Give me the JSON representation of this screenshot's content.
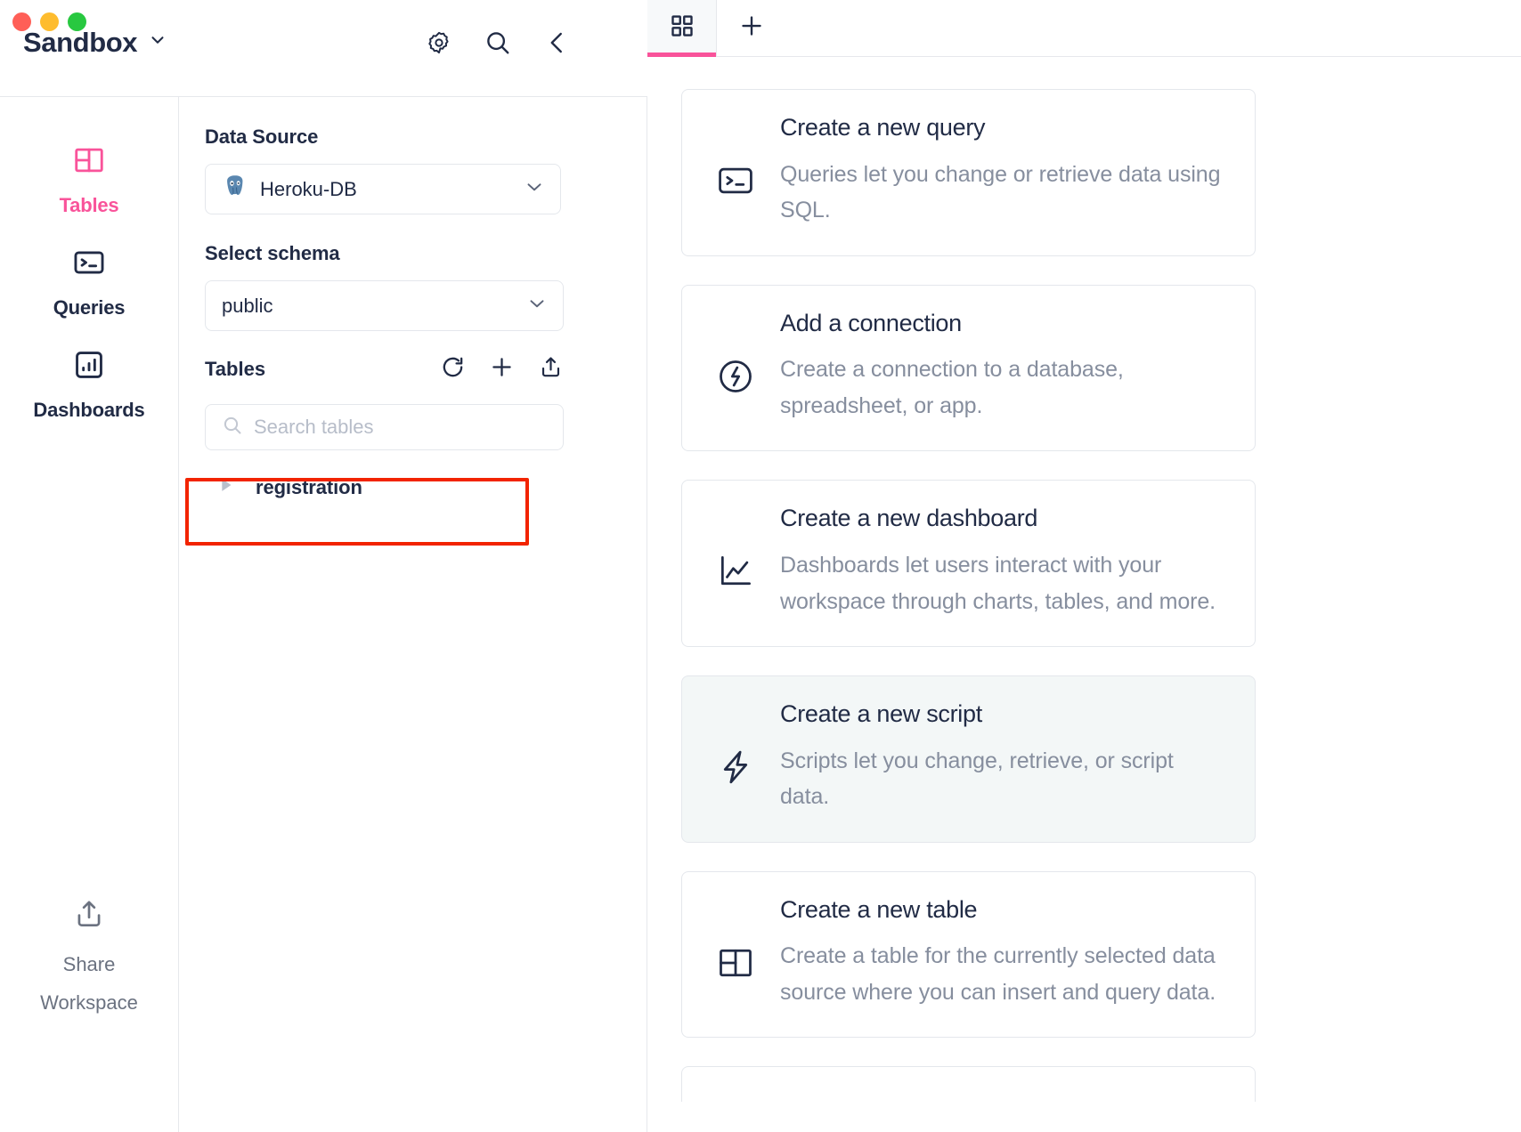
{
  "titlebar": {
    "workspace_name": "Sandbox",
    "workspace_chevron": "chevron-down-icon",
    "actions": [
      {
        "name": "settings-icon",
        "label": "Settings"
      },
      {
        "name": "search-icon",
        "label": "Search"
      },
      {
        "name": "collapse-icon",
        "label": "Collapse sidebar"
      }
    ]
  },
  "rail": {
    "items": [
      {
        "label": "Tables",
        "icon": "tables-icon",
        "active": true
      },
      {
        "label": "Queries",
        "icon": "terminal-icon",
        "active": false
      },
      {
        "label": "Dashboards",
        "icon": "chart-icon",
        "active": false
      }
    ],
    "bottom": {
      "label_line1": "Share",
      "label_line2": "Workspace",
      "icon": "share-upload-icon"
    },
    "active_color": "#f9539a",
    "inactive_color": "#212b45"
  },
  "panel": {
    "data_source_label": "Data Source",
    "data_source_value": "Heroku-DB",
    "data_source_icon": "postgresql-icon",
    "schema_label": "Select schema",
    "schema_value": "public",
    "tables_label": "Tables",
    "tables_actions": [
      {
        "name": "refresh-icon",
        "label": "Refresh"
      },
      {
        "name": "plus-icon",
        "label": "Add table"
      },
      {
        "name": "upload-icon",
        "label": "Import"
      }
    ],
    "search_placeholder": "Search tables",
    "search_value": "",
    "tables": [
      {
        "name": "registration",
        "expanded": false,
        "highlighted": true
      }
    ],
    "highlight_color": "#f22400"
  },
  "main": {
    "tabs": [
      {
        "icon": "grid-icon",
        "active": true,
        "label": "Home"
      }
    ],
    "add_tab_icon": "plus-icon",
    "accent_color": "#f9539a",
    "cards": [
      {
        "title": "Create a new query",
        "desc": "Queries let you change or retrieve data using SQL.",
        "icon": "terminal-icon",
        "hovered": false
      },
      {
        "title": "Add a connection",
        "desc": "Create a connection to a database, spreadsheet, or app.",
        "icon": "connection-bolt-circle-icon",
        "hovered": false
      },
      {
        "title": "Create a new dashboard",
        "desc": "Dashboards let users interact with your workspace through charts, tables, and more.",
        "icon": "line-chart-icon",
        "hovered": false
      },
      {
        "title": "Create a new script",
        "desc": "Scripts let you change, retrieve, or script data.",
        "icon": "bolt-icon",
        "hovered": true
      },
      {
        "title": "Create a new table",
        "desc": "Create a table for the currently selected data source where you can insert and query data.",
        "icon": "tables-icon",
        "hovered": false
      }
    ]
  }
}
